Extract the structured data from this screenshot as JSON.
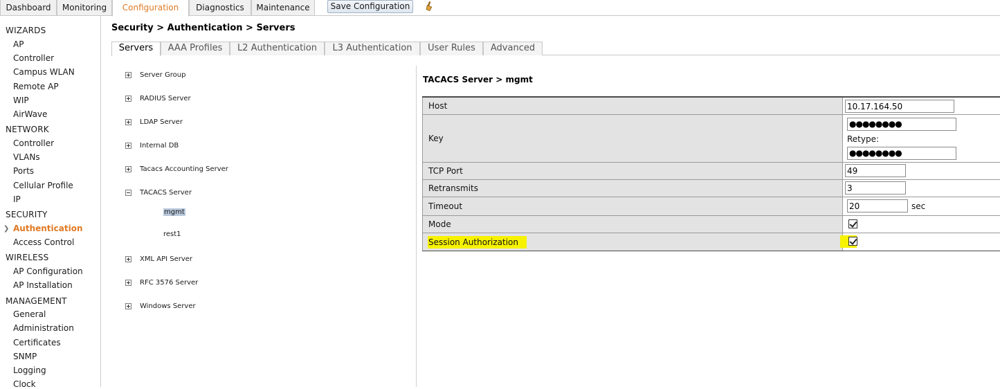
{
  "top_tabs": [
    "Dashboard",
    "Monitoring",
    "Configuration",
    "Diagnostics",
    "Maintenance"
  ],
  "active_top_tab": "Configuration",
  "save_button": "Save Configuration",
  "sidebar": {
    "sections": [
      {
        "title": "WIZARDS",
        "items": [
          "AP",
          "Controller",
          "Campus WLAN",
          "Remote AP",
          "WIP",
          "AirWave"
        ]
      },
      {
        "title": "NETWORK",
        "items": [
          "Controller",
          "VLANs",
          "Ports",
          "Cellular Profile",
          "IP"
        ]
      },
      {
        "title": "SECURITY",
        "items": [
          "Authentication",
          "Access Control"
        ]
      },
      {
        "title": "WIRELESS",
        "items": [
          "AP Configuration",
          "AP Installation"
        ]
      },
      {
        "title": "MANAGEMENT",
        "items": [
          "General",
          "Administration",
          "Certificates",
          "SNMP",
          "Logging",
          "Clock"
        ]
      }
    ],
    "active_item": "Authentication"
  },
  "breadcrumb": "Security > Authentication > Servers",
  "sub_tabs": [
    "Servers",
    "AAA Profiles",
    "L2 Authentication",
    "L3 Authentication",
    "User Rules",
    "Advanced"
  ],
  "active_sub_tab": "Servers",
  "tree": {
    "nodes": [
      "Server Group",
      "RADIUS Server",
      "LDAP Server",
      "Internal DB",
      "Tacacs Accounting Server",
      "TACACS Server",
      "XML API Server",
      "RFC 3576 Server",
      "Windows Server"
    ],
    "expanded_node": "TACACS Server",
    "children": [
      "mgmt",
      "rest1"
    ],
    "selected_child": "mgmt"
  },
  "panel": {
    "title": "TACACS Server > mgmt",
    "host_label": "Host",
    "host_value": "10.17.164.50",
    "key_label": "Key",
    "key_value": "●●●●●●●●",
    "retype_label": "Retype:",
    "retype_value": "●●●●●●●●",
    "tcp_port_label": "TCP Port",
    "tcp_port_value": "49",
    "retransmits_label": "Retransmits",
    "retransmits_value": "3",
    "timeout_label": "Timeout",
    "timeout_value": "20",
    "timeout_unit": "sec",
    "mode_label": "Mode",
    "mode_checked": true,
    "session_auth_label": "Session Authorization",
    "session_auth_checked": true
  },
  "colors": {
    "accent": "#e07a24",
    "highlight": "#f7f200",
    "label_bg": "#e3e3e3"
  }
}
